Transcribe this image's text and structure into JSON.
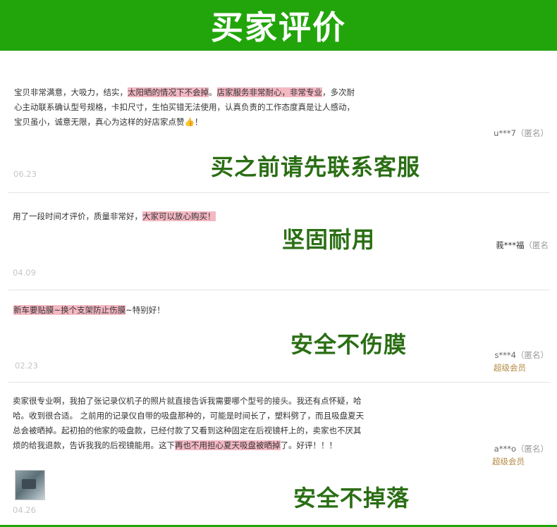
{
  "header": {
    "title": "买家评价"
  },
  "reviews": [
    {
      "segments": [
        {
          "text": "宝贝非常满意，大吸力，结实，",
          "hl": false
        },
        {
          "text": "太阳晒的情况下不会掉",
          "hl": true
        },
        {
          "text": "。",
          "hl": false
        },
        {
          "text": "店家服务非常耐心，非常专业",
          "hl": true
        },
        {
          "text": "，多次耐心主动联系确认型号规格，卡扣尺寸，生怕买错无法使用，认真负责的工作态度真是让人感动，宝贝虽小，诚意无限，真心为这样的好店家点赞👍！",
          "hl": false
        }
      ],
      "user": "u***7",
      "anon": "（匿名）",
      "date": "06.23",
      "overlay": "买之前请先联系客服"
    },
    {
      "segments": [
        {
          "text": "用了一段时间才评价，质量非常好，",
          "hl": false
        },
        {
          "text": "大家可以放心购买！",
          "hl": true
        }
      ],
      "user": "莪***福",
      "anon": "（匿名",
      "date": "04.09",
      "overlay": "坚固耐用"
    },
    {
      "segments": [
        {
          "text": "新车要贴膜~换个支架防止伤膜",
          "hl": true
        },
        {
          "text": "~特别好！",
          "hl": false
        }
      ],
      "user": "s***4",
      "anon": "（匿名）",
      "vip": "超级会员",
      "date": "02.23",
      "overlay": "安全不伤膜"
    },
    {
      "segments": [
        {
          "text": "卖家很专业啊，我拍了张记录仪机子的照片就直接告诉我需要哪个型号的接头。我还有点怀疑，哈哈。收到很合适。 之前用的记录仪自带的吸盘那种的，可能是时间长了，塑料劈了，而且吸盘夏天总会被晒掉。起初拍的他家的吸盘款，已经付款了又看到这种固定在后视镜杆上的，卖家也不厌其烦的给我退款，告诉我我的后视镜能用。这下",
          "hl": false
        },
        {
          "text": "再也不用担心夏天吸盘被晒掉",
          "hl": true
        },
        {
          "text": "了。好评！！！",
          "hl": false
        }
      ],
      "user": "a***o",
      "anon": "（匿名）",
      "vip": "超级会员",
      "date": "04.26",
      "overlay": "安全不掉落"
    }
  ]
}
